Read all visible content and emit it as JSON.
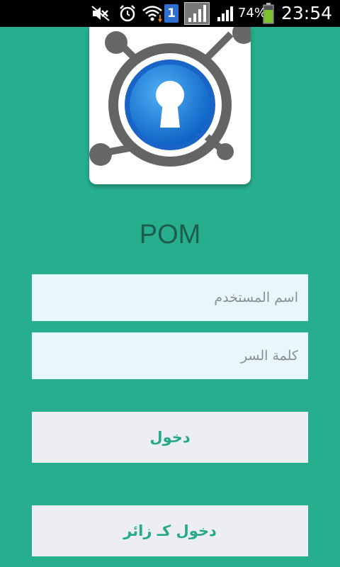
{
  "status_bar": {
    "sim_slot": "1",
    "battery_percent": "74%",
    "battery_level": 0.74,
    "time": "23:54",
    "icons": [
      "mute-icon",
      "alarm-icon",
      "wifi-icon",
      "sim-icon",
      "signal-icon",
      "signal-icon",
      "battery-icon"
    ]
  },
  "app": {
    "title": "POM",
    "logo_icon": "keyhole-lock-icon"
  },
  "form": {
    "username_placeholder": "اسم المستخدم",
    "username_value": "",
    "password_placeholder": "كلمة السر",
    "password_value": "",
    "login_label": "دخول",
    "guest_login_label": "دخول كـ زائر"
  },
  "colors": {
    "background": "#26ae8f",
    "title": "#1d5d4c",
    "button_text": "#26a98a",
    "field_bg": "#e8f6fd",
    "button_bg": "#eceef2"
  }
}
